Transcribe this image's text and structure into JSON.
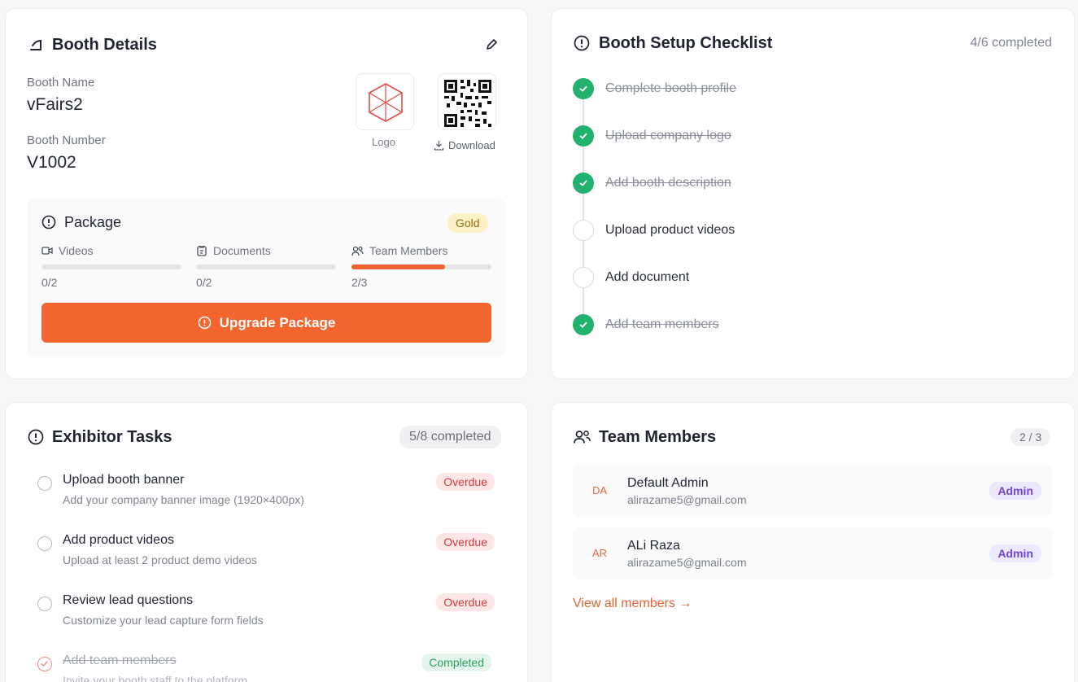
{
  "booth_details": {
    "title": "Booth Details",
    "booth_name_label": "Booth Name",
    "booth_name": "vFairs2",
    "booth_number_label": "Booth Number",
    "booth_number": "V1002",
    "logo_label": "Logo",
    "download_label": "Download",
    "package": {
      "title": "Package",
      "tier": "Gold",
      "stats": [
        {
          "label": "Videos",
          "value": "0/2",
          "progress": 0
        },
        {
          "label": "Documents",
          "value": "0/2",
          "progress": 0
        },
        {
          "label": "Team Members",
          "value": "2/3",
          "progress": 0.667
        }
      ],
      "upgrade_label": "Upgrade Package"
    }
  },
  "checklist": {
    "title": "Booth Setup Checklist",
    "progress": "4/6 completed",
    "items": [
      {
        "label": "Complete booth profile",
        "done": true
      },
      {
        "label": "Upload company logo",
        "done": true
      },
      {
        "label": "Add booth description",
        "done": true
      },
      {
        "label": "Upload product videos",
        "done": false
      },
      {
        "label": "Add document",
        "done": false
      },
      {
        "label": "Add team members",
        "done": true
      }
    ]
  },
  "tasks": {
    "title": "Exhibitor Tasks",
    "progress": "5/8 completed",
    "items": [
      {
        "title": "Upload booth banner",
        "desc": "Add your company banner image (1920×400px)",
        "status": "Overdue"
      },
      {
        "title": "Add product videos",
        "desc": "Upload at least 2 product demo videos",
        "status": "Overdue"
      },
      {
        "title": "Review lead questions",
        "desc": "Customize your lead capture form fields",
        "status": "Overdue"
      },
      {
        "title": "Add team members",
        "desc": "Invite your booth staff to the platform",
        "status": "Completed"
      }
    ]
  },
  "team": {
    "title": "Team Members",
    "count": "2 / 3",
    "members": [
      {
        "initials": "DA",
        "name": "Default Admin",
        "email": "alirazame5@gmail.com",
        "role": "Admin"
      },
      {
        "initials": "AR",
        "name": "ALi Raza",
        "email": "alirazame5@gmail.com",
        "role": "Admin"
      }
    ],
    "view_all": "View all members →"
  },
  "colors": {
    "accent": "#f2652f",
    "success": "#23b26d",
    "danger": "#d03c3c",
    "purple": "#6f45cf"
  }
}
